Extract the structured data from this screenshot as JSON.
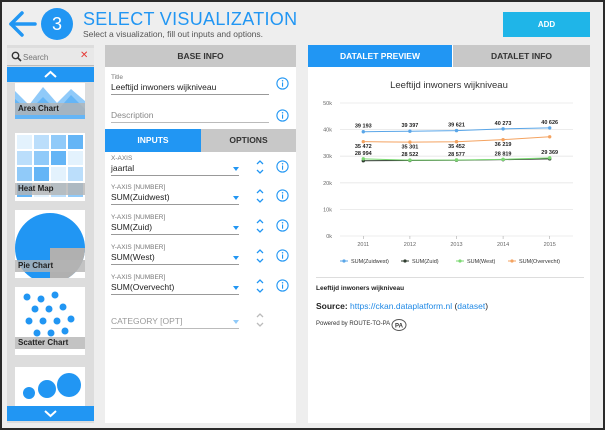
{
  "header": {
    "step_number": "3",
    "title": "SELECT VISUALIZATION",
    "subtitle": "Select a visualization, fill out inputs and options.",
    "add_label": "ADD"
  },
  "sidebar": {
    "search_placeholder": "Search",
    "items": [
      {
        "label": "Area Chart",
        "icon": "area-chart-icon"
      },
      {
        "label": "Heat Map",
        "icon": "heat-map-icon"
      },
      {
        "label": "Pie Chart",
        "icon": "pie-chart-icon"
      },
      {
        "label": "Scatter Chart",
        "icon": "scatter-chart-icon"
      }
    ]
  },
  "base_info": {
    "tab_label": "BASE INFO",
    "title_label": "Title",
    "title_value": "Leeftijd inwoners wijkniveau",
    "description_placeholder": "Description",
    "subtabs": {
      "inputs": "INPUTS",
      "options": "OPTIONS"
    },
    "inputs": [
      {
        "label": "X-AXIS",
        "value": "jaartal"
      },
      {
        "label": "Y-AXIS [NUMBER]",
        "value": "SUM(Zuidwest)"
      },
      {
        "label": "Y-AXIS [NUMBER]",
        "value": "SUM(Zuid)"
      },
      {
        "label": "Y-AXIS [NUMBER]",
        "value": "SUM(West)"
      },
      {
        "label": "Y-AXIS [NUMBER]",
        "value": "SUM(Overvecht)"
      }
    ],
    "category_placeholder": "CATEGORY [OPT]"
  },
  "right": {
    "tabs": {
      "preview": "DATALET PREVIEW",
      "info": "DATALET INFO"
    },
    "footer_title": "Leeftijd inwoners wijkniveau",
    "source_label": "Source:",
    "source_link": "https://ckan.dataplatform.nl",
    "dataset_link": "dataset",
    "powered_by": "Powered by ROUTE-TO-PA",
    "pa_badge": "PA"
  },
  "colors": {
    "accent": "#2196f3",
    "add_button": "#1fb5e8",
    "series": [
      "#5aa6e8",
      "#2f3d2f",
      "#7bd872",
      "#f4a361"
    ]
  },
  "chart_data": {
    "type": "line",
    "title": "Leeftijd inwoners wijkniveau",
    "x": [
      "2011",
      "2012",
      "2013",
      "2014",
      "2015"
    ],
    "y_ticks": [
      "0k",
      "10k",
      "20k",
      "30k",
      "40k",
      "50k"
    ],
    "ylim": [
      0,
      50000
    ],
    "grid": true,
    "legend": "bottom",
    "series": [
      {
        "name": "SUM(Zuidwest)",
        "values": [
          39193,
          39397,
          39621,
          40273,
          40626
        ],
        "labels": [
          "39 193",
          "39 397",
          "39 621",
          "40 273",
          "40 626"
        ]
      },
      {
        "name": "SUM(Zuid)",
        "values": [
          28300,
          28400,
          28500,
          28700,
          29000
        ],
        "labels": []
      },
      {
        "name": "SUM(West)",
        "values": [
          28994,
          28522,
          28577,
          28819,
          29369
        ],
        "labels": [
          "28 994",
          "28 522",
          "28 577",
          "28 819",
          "29 369"
        ]
      },
      {
        "name": "SUM(Overvecht)",
        "values": [
          35472,
          35301,
          35452,
          36219,
          37300
        ],
        "labels": [
          "35 472",
          "35 301",
          "35 452",
          "36 219",
          ""
        ]
      }
    ]
  }
}
